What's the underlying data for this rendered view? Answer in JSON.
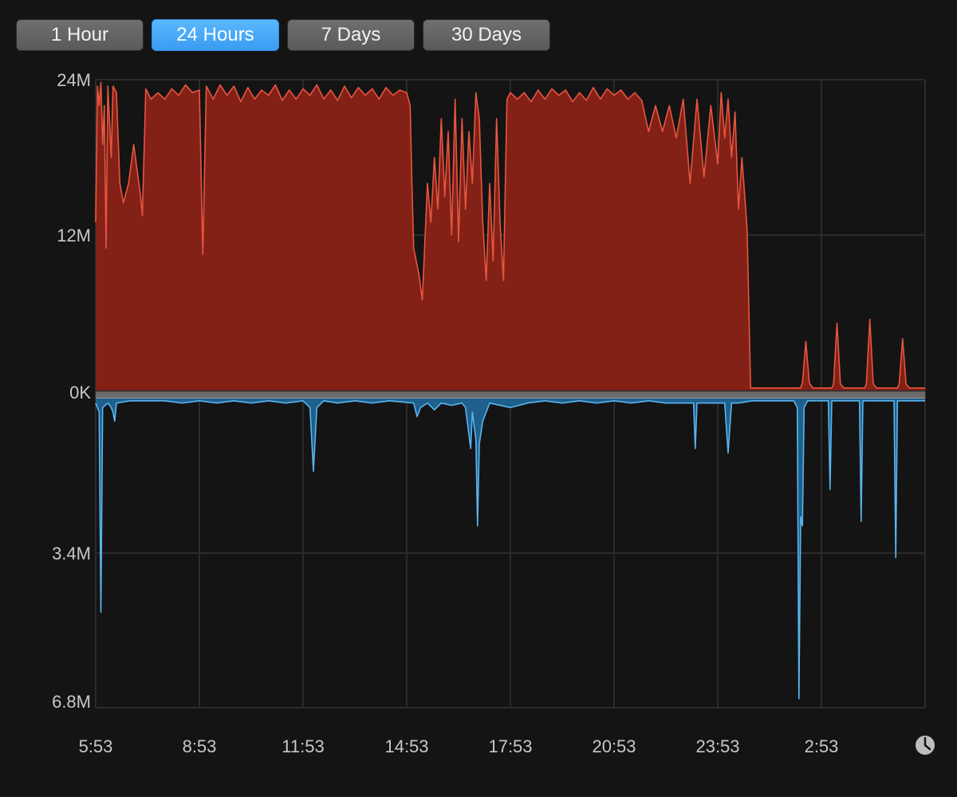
{
  "tabs": [
    {
      "label": "1 Hour",
      "active": false
    },
    {
      "label": "24 Hours",
      "active": true
    },
    {
      "label": "7 Days",
      "active": false
    },
    {
      "label": "30 Days",
      "active": false
    }
  ],
  "icons": {
    "clock": "clock-icon"
  },
  "colors": {
    "upper_line": "#e8553f",
    "upper_fill": "#832117",
    "lower_line": "#5ab4ef",
    "lower_fill": "#1e5f8c",
    "tab_active": "#46a8f8",
    "grid": "#2b2b2b"
  },
  "chart_data": {
    "type": "area",
    "x_ticks": [
      "5:53",
      "8:53",
      "11:53",
      "14:53",
      "17:53",
      "20:53",
      "23:53",
      "2:53"
    ],
    "upper": {
      "y_ticks": [
        "24M",
        "12M",
        "0K"
      ],
      "ylim": [
        0,
        24
      ],
      "unit": "M",
      "points": [
        [
          0,
          13
        ],
        [
          0.05,
          23.5
        ],
        [
          0.1,
          22
        ],
        [
          0.15,
          23.8
        ],
        [
          0.2,
          19
        ],
        [
          0.25,
          22
        ],
        [
          0.3,
          11
        ],
        [
          0.35,
          23.5
        ],
        [
          0.45,
          18
        ],
        [
          0.5,
          23.5
        ],
        [
          0.6,
          23
        ],
        [
          0.7,
          16
        ],
        [
          0.8,
          14.5
        ],
        [
          0.95,
          16
        ],
        [
          1.1,
          19
        ],
        [
          1.2,
          17
        ],
        [
          1.3,
          15
        ],
        [
          1.35,
          13.5
        ],
        [
          1.45,
          23.3
        ],
        [
          1.6,
          22.5
        ],
        [
          1.8,
          23
        ],
        [
          2,
          22.5
        ],
        [
          2.2,
          23.3
        ],
        [
          2.4,
          22.8
        ],
        [
          2.6,
          23.6
        ],
        [
          2.8,
          23
        ],
        [
          3,
          23.2
        ],
        [
          3.1,
          10.5
        ],
        [
          3.2,
          23.5
        ],
        [
          3.4,
          22.5
        ],
        [
          3.6,
          23.6
        ],
        [
          3.8,
          22.8
        ],
        [
          4,
          23.5
        ],
        [
          4.2,
          22.3
        ],
        [
          4.4,
          23.4
        ],
        [
          4.6,
          22.5
        ],
        [
          4.8,
          23.2
        ],
        [
          5,
          22.8
        ],
        [
          5.2,
          23.6
        ],
        [
          5.4,
          22.4
        ],
        [
          5.6,
          23.2
        ],
        [
          5.8,
          22.5
        ],
        [
          6,
          23.3
        ],
        [
          6.2,
          22.8
        ],
        [
          6.4,
          23.6
        ],
        [
          6.6,
          22.5
        ],
        [
          6.8,
          23.2
        ],
        [
          7,
          22.4
        ],
        [
          7.2,
          23.5
        ],
        [
          7.4,
          22.6
        ],
        [
          7.6,
          23.4
        ],
        [
          7.8,
          22.8
        ],
        [
          8,
          23.3
        ],
        [
          8.2,
          22.5
        ],
        [
          8.4,
          23.4
        ],
        [
          8.6,
          22.8
        ],
        [
          8.8,
          23.2
        ],
        [
          9,
          23
        ],
        [
          9.1,
          22
        ],
        [
          9.15,
          16
        ],
        [
          9.2,
          11
        ],
        [
          9.35,
          9
        ],
        [
          9.45,
          7
        ],
        [
          9.5,
          10
        ],
        [
          9.6,
          16
        ],
        [
          9.7,
          13
        ],
        [
          9.8,
          18
        ],
        [
          9.9,
          14
        ],
        [
          10,
          21
        ],
        [
          10.1,
          15
        ],
        [
          10.2,
          20
        ],
        [
          10.3,
          12
        ],
        [
          10.4,
          22.5
        ],
        [
          10.5,
          11.5
        ],
        [
          10.6,
          21
        ],
        [
          10.7,
          14
        ],
        [
          10.8,
          20
        ],
        [
          10.9,
          16
        ],
        [
          11,
          23
        ],
        [
          11.1,
          21
        ],
        [
          11.2,
          13
        ],
        [
          11.3,
          8.5
        ],
        [
          11.4,
          16
        ],
        [
          11.5,
          10
        ],
        [
          11.6,
          21
        ],
        [
          11.7,
          13
        ],
        [
          11.8,
          8.5
        ],
        [
          11.9,
          22.5
        ],
        [
          12,
          23
        ],
        [
          12.2,
          22.5
        ],
        [
          12.4,
          23
        ],
        [
          12.6,
          22.3
        ],
        [
          12.8,
          23.2
        ],
        [
          13,
          22.5
        ],
        [
          13.2,
          23.3
        ],
        [
          13.4,
          22.8
        ],
        [
          13.6,
          23.2
        ],
        [
          13.8,
          22.3
        ],
        [
          14,
          23
        ],
        [
          14.2,
          22.4
        ],
        [
          14.4,
          23.4
        ],
        [
          14.6,
          22.5
        ],
        [
          14.8,
          23.3
        ],
        [
          15,
          22.8
        ],
        [
          15.2,
          23.2
        ],
        [
          15.4,
          22.5
        ],
        [
          15.6,
          23
        ],
        [
          15.8,
          22.4
        ],
        [
          16,
          20
        ],
        [
          16.2,
          22
        ],
        [
          16.4,
          20
        ],
        [
          16.6,
          22
        ],
        [
          16.8,
          19.5
        ],
        [
          17,
          22.5
        ],
        [
          17.2,
          16
        ],
        [
          17.4,
          22.5
        ],
        [
          17.6,
          16.5
        ],
        [
          17.8,
          22
        ],
        [
          18,
          17.5
        ],
        [
          18.1,
          23
        ],
        [
          18.2,
          19.5
        ],
        [
          18.3,
          22.5
        ],
        [
          18.4,
          18
        ],
        [
          18.5,
          21.5
        ],
        [
          18.6,
          14
        ],
        [
          18.7,
          18
        ],
        [
          18.85,
          12.5
        ],
        [
          18.95,
          0.2
        ],
        [
          19.2,
          0.2
        ],
        [
          19.5,
          0.2
        ],
        [
          19.8,
          0.2
        ],
        [
          20.1,
          0.2
        ],
        [
          20.4,
          0.2
        ],
        [
          20.45,
          0.6
        ],
        [
          20.55,
          3.8
        ],
        [
          20.65,
          0.6
        ],
        [
          20.75,
          0.2
        ],
        [
          21,
          0.2
        ],
        [
          21.3,
          0.2
        ],
        [
          21.35,
          0.5
        ],
        [
          21.45,
          5.2
        ],
        [
          21.55,
          0.5
        ],
        [
          21.65,
          0.2
        ],
        [
          22,
          0.2
        ],
        [
          22.25,
          0.2
        ],
        [
          22.3,
          0.5
        ],
        [
          22.4,
          5.5
        ],
        [
          22.5,
          0.5
        ],
        [
          22.6,
          0.2
        ],
        [
          23,
          0.2
        ],
        [
          23.2,
          0.2
        ],
        [
          23.25,
          0.5
        ],
        [
          23.35,
          4
        ],
        [
          23.45,
          0.5
        ],
        [
          23.55,
          0.2
        ],
        [
          24,
          0.2
        ]
      ]
    },
    "lower": {
      "y_ticks": [
        "0K",
        "3.4M",
        "6.8M"
      ],
      "ylim": [
        0,
        6.8
      ],
      "unit": "M",
      "points": [
        [
          0,
          0.1
        ],
        [
          0.1,
          0.3
        ],
        [
          0.15,
          4.7
        ],
        [
          0.2,
          0.2
        ],
        [
          0.35,
          0.1
        ],
        [
          0.45,
          0.2
        ],
        [
          0.5,
          0.3
        ],
        [
          0.55,
          0.5
        ],
        [
          0.6,
          0.1
        ],
        [
          1,
          0.05
        ],
        [
          1.5,
          0.05
        ],
        [
          2,
          0.05
        ],
        [
          2.5,
          0.1
        ],
        [
          3,
          0.05
        ],
        [
          3.5,
          0.1
        ],
        [
          4,
          0.05
        ],
        [
          4.5,
          0.1
        ],
        [
          5,
          0.05
        ],
        [
          5.5,
          0.1
        ],
        [
          6,
          0.05
        ],
        [
          6.2,
          0.2
        ],
        [
          6.3,
          1.6
        ],
        [
          6.4,
          0.2
        ],
        [
          6.6,
          0.05
        ],
        [
          7,
          0.1
        ],
        [
          7.5,
          0.05
        ],
        [
          8,
          0.1
        ],
        [
          8.5,
          0.05
        ],
        [
          9.2,
          0.1
        ],
        [
          9.3,
          0.4
        ],
        [
          9.4,
          0.2
        ],
        [
          9.6,
          0.1
        ],
        [
          9.8,
          0.25
        ],
        [
          10,
          0.1
        ],
        [
          10.3,
          0.15
        ],
        [
          10.6,
          0.1
        ],
        [
          10.7,
          0.2
        ],
        [
          10.8,
          0.8
        ],
        [
          10.85,
          1.1
        ],
        [
          10.9,
          0.3
        ],
        [
          11,
          0.9
        ],
        [
          11.05,
          2.8
        ],
        [
          11.1,
          1
        ],
        [
          11.2,
          0.5
        ],
        [
          11.4,
          0.1
        ],
        [
          12,
          0.2
        ],
        [
          12.5,
          0.1
        ],
        [
          13,
          0.05
        ],
        [
          13.5,
          0.1
        ],
        [
          14,
          0.05
        ],
        [
          14.5,
          0.1
        ],
        [
          15,
          0.05
        ],
        [
          15.5,
          0.1
        ],
        [
          16,
          0.05
        ],
        [
          16.5,
          0.1
        ],
        [
          17,
          0.1
        ],
        [
          17.3,
          0.1
        ],
        [
          17.35,
          1.1
        ],
        [
          17.4,
          0.1
        ],
        [
          18,
          0.1
        ],
        [
          18.2,
          0.1
        ],
        [
          18.3,
          1.2
        ],
        [
          18.4,
          0.1
        ],
        [
          18.6,
          0.1
        ],
        [
          19,
          0.05
        ],
        [
          19.5,
          0.05
        ],
        [
          20.2,
          0.05
        ],
        [
          20.3,
          0.2
        ],
        [
          20.35,
          6.6
        ],
        [
          20.4,
          2.6
        ],
        [
          20.45,
          2.8
        ],
        [
          20.5,
          0.2
        ],
        [
          20.6,
          0.05
        ],
        [
          21,
          0.05
        ],
        [
          21.2,
          0.05
        ],
        [
          21.25,
          2
        ],
        [
          21.3,
          0.05
        ],
        [
          22,
          0.05
        ],
        [
          22.1,
          0.05
        ],
        [
          22.15,
          2.7
        ],
        [
          22.2,
          0.05
        ],
        [
          23,
          0.05
        ],
        [
          23.1,
          0.05
        ],
        [
          23.15,
          3.5
        ],
        [
          23.2,
          0.05
        ],
        [
          24,
          0.05
        ]
      ]
    },
    "legend": "none",
    "grid": true
  }
}
